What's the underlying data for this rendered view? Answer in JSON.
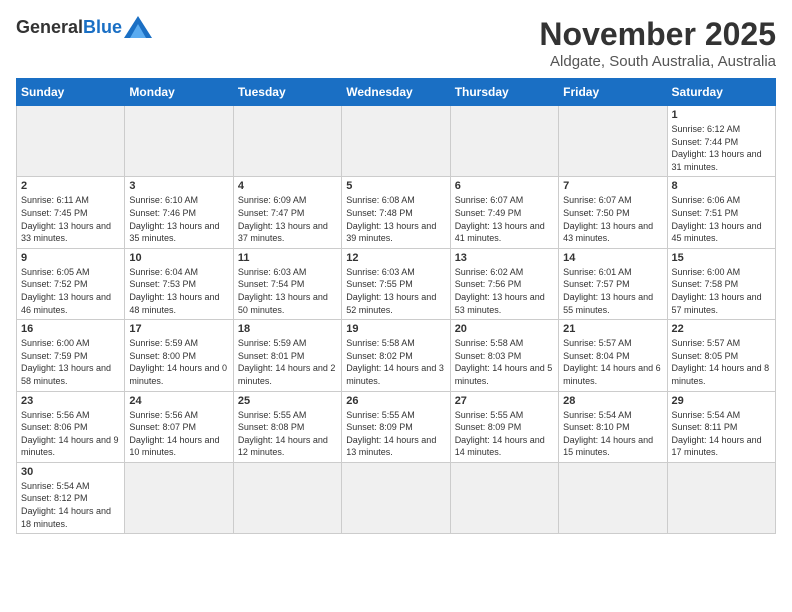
{
  "logo": {
    "general": "General",
    "blue": "Blue"
  },
  "header": {
    "month": "November 2025",
    "location": "Aldgate, South Australia, Australia"
  },
  "weekdays": [
    "Sunday",
    "Monday",
    "Tuesday",
    "Wednesday",
    "Thursday",
    "Friday",
    "Saturday"
  ],
  "days": [
    {
      "date": "",
      "info": ""
    },
    {
      "date": "",
      "info": ""
    },
    {
      "date": "",
      "info": ""
    },
    {
      "date": "",
      "info": ""
    },
    {
      "date": "",
      "info": ""
    },
    {
      "date": "",
      "info": ""
    },
    {
      "date": "1",
      "sunrise": "Sunrise: 6:12 AM",
      "sunset": "Sunset: 7:44 PM",
      "daylight": "Daylight: 13 hours and 31 minutes."
    },
    {
      "date": "2",
      "sunrise": "Sunrise: 6:11 AM",
      "sunset": "Sunset: 7:45 PM",
      "daylight": "Daylight: 13 hours and 33 minutes."
    },
    {
      "date": "3",
      "sunrise": "Sunrise: 6:10 AM",
      "sunset": "Sunset: 7:46 PM",
      "daylight": "Daylight: 13 hours and 35 minutes."
    },
    {
      "date": "4",
      "sunrise": "Sunrise: 6:09 AM",
      "sunset": "Sunset: 7:47 PM",
      "daylight": "Daylight: 13 hours and 37 minutes."
    },
    {
      "date": "5",
      "sunrise": "Sunrise: 6:08 AM",
      "sunset": "Sunset: 7:48 PM",
      "daylight": "Daylight: 13 hours and 39 minutes."
    },
    {
      "date": "6",
      "sunrise": "Sunrise: 6:07 AM",
      "sunset": "Sunset: 7:49 PM",
      "daylight": "Daylight: 13 hours and 41 minutes."
    },
    {
      "date": "7",
      "sunrise": "Sunrise: 6:07 AM",
      "sunset": "Sunset: 7:50 PM",
      "daylight": "Daylight: 13 hours and 43 minutes."
    },
    {
      "date": "8",
      "sunrise": "Sunrise: 6:06 AM",
      "sunset": "Sunset: 7:51 PM",
      "daylight": "Daylight: 13 hours and 45 minutes."
    },
    {
      "date": "9",
      "sunrise": "Sunrise: 6:05 AM",
      "sunset": "Sunset: 7:52 PM",
      "daylight": "Daylight: 13 hours and 46 minutes."
    },
    {
      "date": "10",
      "sunrise": "Sunrise: 6:04 AM",
      "sunset": "Sunset: 7:53 PM",
      "daylight": "Daylight: 13 hours and 48 minutes."
    },
    {
      "date": "11",
      "sunrise": "Sunrise: 6:03 AM",
      "sunset": "Sunset: 7:54 PM",
      "daylight": "Daylight: 13 hours and 50 minutes."
    },
    {
      "date": "12",
      "sunrise": "Sunrise: 6:03 AM",
      "sunset": "Sunset: 7:55 PM",
      "daylight": "Daylight: 13 hours and 52 minutes."
    },
    {
      "date": "13",
      "sunrise": "Sunrise: 6:02 AM",
      "sunset": "Sunset: 7:56 PM",
      "daylight": "Daylight: 13 hours and 53 minutes."
    },
    {
      "date": "14",
      "sunrise": "Sunrise: 6:01 AM",
      "sunset": "Sunset: 7:57 PM",
      "daylight": "Daylight: 13 hours and 55 minutes."
    },
    {
      "date": "15",
      "sunrise": "Sunrise: 6:00 AM",
      "sunset": "Sunset: 7:58 PM",
      "daylight": "Daylight: 13 hours and 57 minutes."
    },
    {
      "date": "16",
      "sunrise": "Sunrise: 6:00 AM",
      "sunset": "Sunset: 7:59 PM",
      "daylight": "Daylight: 13 hours and 58 minutes."
    },
    {
      "date": "17",
      "sunrise": "Sunrise: 5:59 AM",
      "sunset": "Sunset: 8:00 PM",
      "daylight": "Daylight: 14 hours and 0 minutes."
    },
    {
      "date": "18",
      "sunrise": "Sunrise: 5:59 AM",
      "sunset": "Sunset: 8:01 PM",
      "daylight": "Daylight: 14 hours and 2 minutes."
    },
    {
      "date": "19",
      "sunrise": "Sunrise: 5:58 AM",
      "sunset": "Sunset: 8:02 PM",
      "daylight": "Daylight: 14 hours and 3 minutes."
    },
    {
      "date": "20",
      "sunrise": "Sunrise: 5:58 AM",
      "sunset": "Sunset: 8:03 PM",
      "daylight": "Daylight: 14 hours and 5 minutes."
    },
    {
      "date": "21",
      "sunrise": "Sunrise: 5:57 AM",
      "sunset": "Sunset: 8:04 PM",
      "daylight": "Daylight: 14 hours and 6 minutes."
    },
    {
      "date": "22",
      "sunrise": "Sunrise: 5:57 AM",
      "sunset": "Sunset: 8:05 PM",
      "daylight": "Daylight: 14 hours and 8 minutes."
    },
    {
      "date": "23",
      "sunrise": "Sunrise: 5:56 AM",
      "sunset": "Sunset: 8:06 PM",
      "daylight": "Daylight: 14 hours and 9 minutes."
    },
    {
      "date": "24",
      "sunrise": "Sunrise: 5:56 AM",
      "sunset": "Sunset: 8:07 PM",
      "daylight": "Daylight: 14 hours and 10 minutes."
    },
    {
      "date": "25",
      "sunrise": "Sunrise: 5:55 AM",
      "sunset": "Sunset: 8:08 PM",
      "daylight": "Daylight: 14 hours and 12 minutes."
    },
    {
      "date": "26",
      "sunrise": "Sunrise: 5:55 AM",
      "sunset": "Sunset: 8:09 PM",
      "daylight": "Daylight: 14 hours and 13 minutes."
    },
    {
      "date": "27",
      "sunrise": "Sunrise: 5:55 AM",
      "sunset": "Sunset: 8:09 PM",
      "daylight": "Daylight: 14 hours and 14 minutes."
    },
    {
      "date": "28",
      "sunrise": "Sunrise: 5:54 AM",
      "sunset": "Sunset: 8:10 PM",
      "daylight": "Daylight: 14 hours and 15 minutes."
    },
    {
      "date": "29",
      "sunrise": "Sunrise: 5:54 AM",
      "sunset": "Sunset: 8:11 PM",
      "daylight": "Daylight: 14 hours and 17 minutes."
    },
    {
      "date": "30",
      "sunrise": "Sunrise: 5:54 AM",
      "sunset": "Sunset: 8:12 PM",
      "daylight": "Daylight: 14 hours and 18 minutes."
    }
  ]
}
